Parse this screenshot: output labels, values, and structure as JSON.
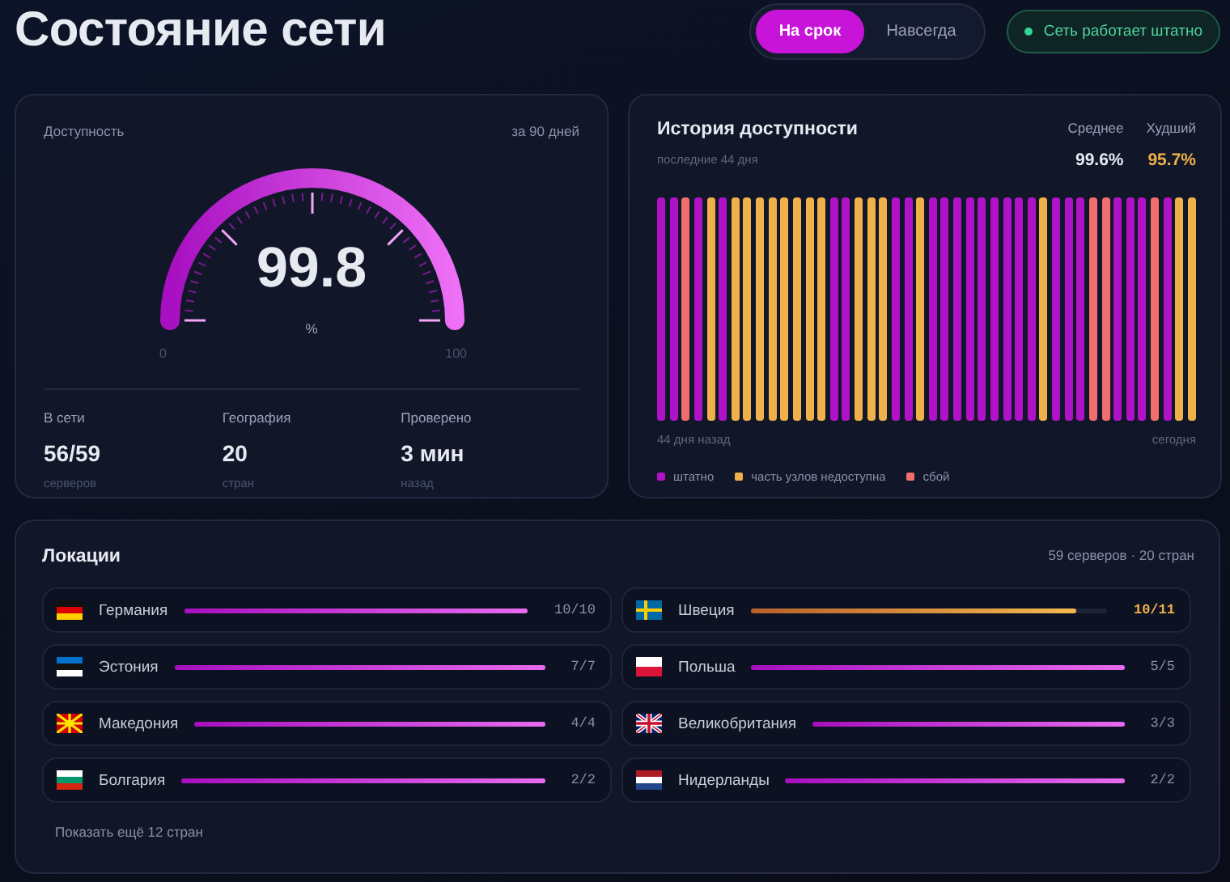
{
  "header": {
    "title": "Состояние сети",
    "toggle": [
      {
        "label": "На срок",
        "selected": true
      },
      {
        "label": "Навсегда",
        "selected": false
      }
    ],
    "status": {
      "label": "Сеть работает штатно",
      "color": "#34d399"
    }
  },
  "availability": {
    "label": "Доступность",
    "period": "за 90 дней",
    "gauge": {
      "value": "99.8",
      "unit": "%",
      "min": "0",
      "max": "100"
    },
    "stats": [
      {
        "label": "В сети",
        "value": "56/59",
        "unit": "серверов"
      },
      {
        "label": "География",
        "value": "20",
        "unit": "стран"
      },
      {
        "label": "Проверено",
        "value": "3 мин",
        "unit": "назад"
      }
    ]
  },
  "history": {
    "title": "История доступности",
    "subtitle": "последние 44 дня",
    "summary": [
      {
        "label": "Среднее",
        "value": "99.6%",
        "warning": false
      },
      {
        "label": "Худший",
        "value": "95.7%",
        "warning": true
      }
    ],
    "days": [
      {
        "color": "#b012c8"
      },
      {
        "color": "#b012c8"
      },
      {
        "color": "#f26d6d"
      },
      {
        "color": "#b012c8"
      },
      {
        "color": "#f0b04a"
      },
      {
        "color": "#b012c8"
      },
      {
        "color": "#f0b04a"
      },
      {
        "color": "#f0b04a"
      },
      {
        "color": "#f0b04a"
      },
      {
        "color": "#f0b04a"
      },
      {
        "color": "#f0b04a"
      },
      {
        "color": "#f0b04a"
      },
      {
        "color": "#f0b04a"
      },
      {
        "color": "#f0b04a"
      },
      {
        "color": "#b012c8"
      },
      {
        "color": "#b012c8"
      },
      {
        "color": "#f0b04a"
      },
      {
        "color": "#f0b04a"
      },
      {
        "color": "#f0b04a"
      },
      {
        "color": "#b012c8"
      },
      {
        "color": "#b012c8"
      },
      {
        "color": "#f0b04a"
      },
      {
        "color": "#b012c8"
      },
      {
        "color": "#b012c8"
      },
      {
        "color": "#b012c8"
      },
      {
        "color": "#b012c8"
      },
      {
        "color": "#b012c8"
      },
      {
        "color": "#b012c8"
      },
      {
        "color": "#b012c8"
      },
      {
        "color": "#b012c8"
      },
      {
        "color": "#b012c8"
      },
      {
        "color": "#f0b04a"
      },
      {
        "color": "#b012c8"
      },
      {
        "color": "#b012c8"
      },
      {
        "color": "#b012c8"
      },
      {
        "color": "#f26d6d"
      },
      {
        "color": "#f26d6d"
      },
      {
        "color": "#b012c8"
      },
      {
        "color": "#b012c8"
      },
      {
        "color": "#b012c8"
      },
      {
        "color": "#f26d6d"
      },
      {
        "color": "#b012c8"
      },
      {
        "color": "#f0b04a"
      },
      {
        "color": "#f0b04a"
      }
    ],
    "start_label": "44 дня назад",
    "end_label": "сегодня",
    "legend": [
      {
        "label": "штатно",
        "color": "#b012c8"
      },
      {
        "label": "часть узлов недоступна",
        "color": "#f0b04a"
      },
      {
        "label": "сбой",
        "color": "#f26d6d"
      }
    ]
  },
  "locations": {
    "title": "Локации",
    "summary": "59 серверов · 20 стран",
    "items": [
      {
        "name": "Германия",
        "kind": "de",
        "count": "10/10",
        "level": 1,
        "warning": false
      },
      {
        "name": "Швеция",
        "kind": "se",
        "count": "10/11",
        "level": 0.91,
        "warning": true
      },
      {
        "name": "Эстония",
        "kind": "ee",
        "count": "7/7",
        "level": 1,
        "warning": false
      },
      {
        "name": "Польша",
        "kind": "pl",
        "count": "5/5",
        "level": 1,
        "warning": false
      },
      {
        "name": "Македония",
        "kind": "mk",
        "count": "4/4",
        "level": 1,
        "warning": false
      },
      {
        "name": "Великобритания",
        "kind": "gb",
        "count": "3/3",
        "level": 1,
        "warning": false
      },
      {
        "name": "Болгария",
        "kind": "bg",
        "count": "2/2",
        "level": 1,
        "warning": false
      },
      {
        "name": "Нидерланды",
        "kind": "nl",
        "count": "2/2",
        "level": 1,
        "warning": false
      }
    ],
    "more": "Показать ещё 12 стран"
  }
}
